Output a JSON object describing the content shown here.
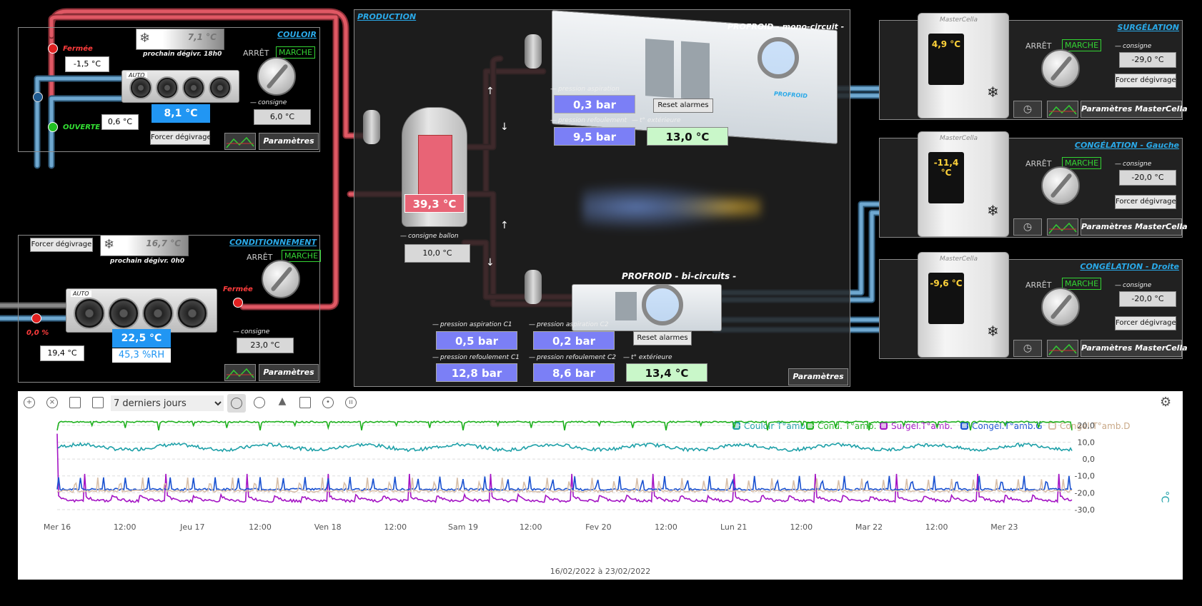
{
  "colors": {
    "background": "#000000",
    "panel": "#212121",
    "title_blue": "#2aa9e8",
    "pipe_hot": "#e05864",
    "pipe_cold": "#6fa8d0",
    "state_on": "#33d433",
    "state_closed": "#e02020",
    "state_open": "#22c022"
  },
  "couloir": {
    "title": "COULOIR",
    "valve_top_label": "Fermée",
    "valve_bottom_label": "OUVERTE",
    "temp_left": "-1,5 °C",
    "temp_coil": "0,6 °C",
    "ambient": "8,1 °C",
    "defrost_temp": "7,1 °C",
    "defrost_next": "prochain dégivr. 18h0",
    "auto": "AUTO",
    "arret": "ARRÊT",
    "marche": "MARCHE",
    "consigne_label": "consigne",
    "consigne": "6,0 °C",
    "force_defrost": "Forcer dégivrage",
    "params": "Paramètres"
  },
  "conditionnement": {
    "title": "CONDITIONNEMENT",
    "force_defrost": "Forcer dégivrage",
    "defrost_temp": "16,7 °C",
    "defrost_next": "prochain dégivr. 0h0",
    "arret": "ARRÊT",
    "marche": "MARCHE",
    "auto": "AUTO",
    "valve_label": "Fermée",
    "valve_pct": "0,0 %",
    "temp_left": "19,4 °C",
    "ambient": "22,5 °C",
    "humidity": "45,3 %RH",
    "consigne_label": "consigne",
    "consigne": "23,0 °C",
    "params": "Paramètres"
  },
  "production": {
    "title": "PRODUCTION",
    "tank_temp": "39,3 °C",
    "tank_consigne_label": "consigne ballon",
    "tank_consigne": "10,0 °C",
    "mono": {
      "title": "PROFROID - mono-circuit -",
      "suction_label": "pression aspiration",
      "suction": "0,3 bar",
      "discharge_label": "pression refoulement",
      "discharge": "9,5 bar",
      "ext_label": "t° extérieure",
      "ext": "13,0 °C",
      "reset": "Reset alarmes",
      "brand": "PROFROID"
    },
    "bi": {
      "title": "PROFROID - bi-circuits -",
      "suction_c1_label": "pression aspiration C1",
      "suction_c1": "0,5 bar",
      "suction_c2_label": "pression aspiration C2",
      "suction_c2": "0,2 bar",
      "discharge_c1_label": "pression refoulement C1",
      "discharge_c1": "12,8 bar",
      "discharge_c2_label": "pression refoulement C2",
      "discharge_c2": "8,6 bar",
      "ext_label": "t° extérieure",
      "ext": "13,4 °C",
      "reset": "Reset alarmes"
    },
    "params": "Paramètres"
  },
  "cells": [
    {
      "title": "SURGÉLATION",
      "display": "4,9 °C",
      "arret": "ARRÊT",
      "marche": "MARCHE",
      "consigne_label": "consigne",
      "consigne": "-29,0 °C",
      "force_defrost": "Forcer dégivrage",
      "params": "Paramètres MasterCella",
      "brand": "MasterCella"
    },
    {
      "title": "CONGÉLATION - Gauche",
      "display": "-11,4 °C",
      "arret": "ARRÊT",
      "marche": "MARCHE",
      "consigne_label": "consigne",
      "consigne": "-20,0 °C",
      "force_defrost": "Forcer dégivrage",
      "params": "Paramètres MasterCella",
      "brand": "MasterCella"
    },
    {
      "title": "CONGÉLATION - Droite",
      "display": "-9,6 °C",
      "arret": "ARRÊT",
      "marche": "MARCHE",
      "consigne_label": "consigne",
      "consigne": "-20,0 °C",
      "force_defrost": "Forcer dégivrage",
      "params": "Paramètres MasterCella",
      "brand": "MasterCella"
    }
  ],
  "toolbar": {
    "period": "7 derniers jours",
    "period_options": [
      "7 derniers jours"
    ]
  },
  "chart_data": {
    "type": "line",
    "title": "",
    "xlabel": "16/02/2022 à 23/02/2022",
    "ylabel": "°C",
    "ylim": [
      -30,
      25
    ],
    "yticks": [
      "20,0",
      "10,0",
      "0,0",
      "-10,0",
      "-20,0",
      "-30,0"
    ],
    "xticks": [
      "Mer 16",
      "12:00",
      "Jeu 17",
      "12:00",
      "Ven 18",
      "12:00",
      "Sam 19",
      "12:00",
      "Fev 20",
      "12:00",
      "Lun 21",
      "12:00",
      "Mar 22",
      "12:00",
      "Mer 23"
    ],
    "x_range_days": [
      0,
      7.5
    ],
    "legend_position": "top-right",
    "series": [
      {
        "name": "Couloir T°amb.",
        "color": "#1ea0a8",
        "base": 7,
        "spike": 3,
        "pattern": "couloir"
      },
      {
        "name": "Cond. T°amb.",
        "color": "#1db01d",
        "base": 22,
        "spike": -5,
        "pattern": "cond"
      },
      {
        "name": "Surgél.T°amb.",
        "color": "#a414c4",
        "base": -25,
        "spike": 40,
        "pattern": "surgel"
      },
      {
        "name": "Congél.T°amb.G",
        "color": "#1850d0",
        "base": -18,
        "spike": 8,
        "pattern": "congelg"
      },
      {
        "name": "Congél.T°amb.D",
        "color": "#d8bfa8",
        "base": -19,
        "spike": 8,
        "pattern": "congeld"
      }
    ]
  }
}
